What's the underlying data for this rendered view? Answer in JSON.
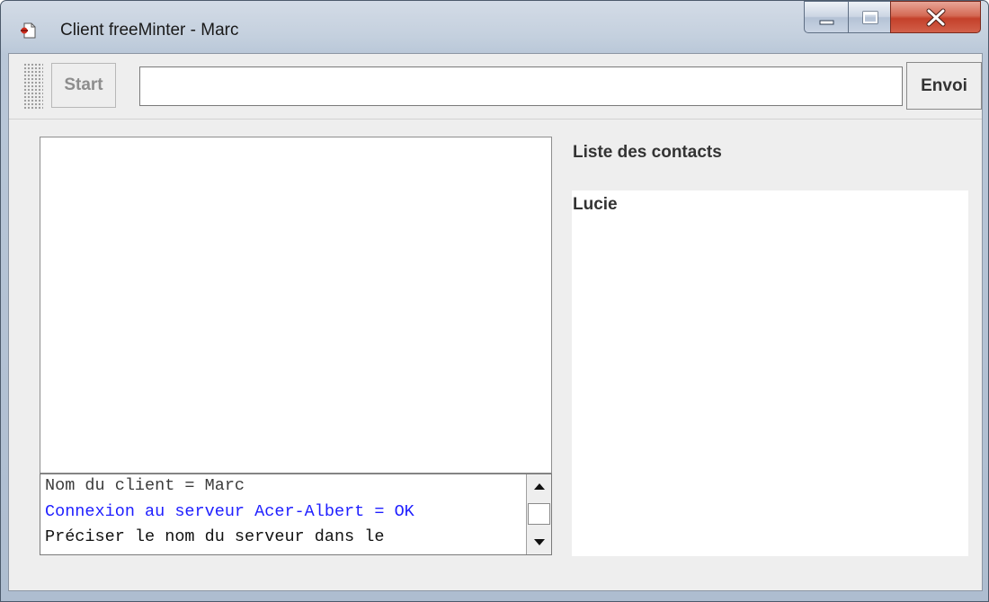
{
  "window": {
    "title": "Client freeMinter - Marc",
    "icon": "app-icon"
  },
  "caption_buttons": {
    "minimize_icon": "minimize-icon",
    "maximize_icon": "maximize-icon",
    "close_icon": "close-icon",
    "close_color": "#c4402a"
  },
  "toolbar": {
    "start_label": "Start",
    "start_enabled": false,
    "message_value": "",
    "send_label": "Envoi"
  },
  "log": {
    "lines": [
      {
        "text": "Nom du client = Marc",
        "color": "#3c3c3c"
      },
      {
        "text": "Connexion au serveur Acer-Albert = OK",
        "color": "#1e1eff"
      },
      {
        "text": "Préciser le nom du serveur dans le",
        "color": "#111111"
      }
    ]
  },
  "contacts": {
    "title": "Liste des contacts",
    "items": [
      "Lucie"
    ]
  },
  "colors": {
    "window_bg": "#eeeeee",
    "panel_bg": "#ffffff",
    "log_blue": "#1e1eff"
  }
}
